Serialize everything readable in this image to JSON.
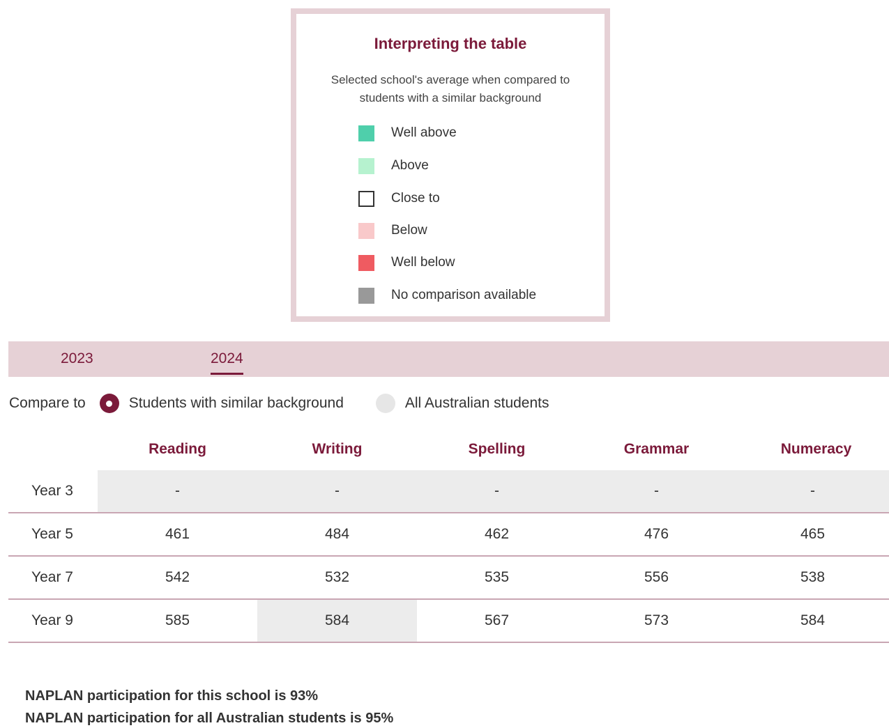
{
  "legend": {
    "title": "Interpreting the table",
    "subtitle_line1": "Selected school's average when compared to",
    "subtitle_line2": "students with a similar background",
    "items": [
      {
        "label": "Well above",
        "color": "#4fcfab"
      },
      {
        "label": "Above",
        "color": "#b6f2cf"
      },
      {
        "label": "Close to",
        "color": "#ffffff"
      },
      {
        "label": "Below",
        "color": "#f9c9ca"
      },
      {
        "label": "Well below",
        "color": "#ef5b61"
      },
      {
        "label": "No comparison available",
        "color": "#999999"
      }
    ]
  },
  "tabs": [
    {
      "label": "2023",
      "active": false
    },
    {
      "label": "2024",
      "active": true
    }
  ],
  "compare": {
    "label": "Compare to",
    "options": [
      {
        "label": "Students with similar background",
        "checked": true
      },
      {
        "label": "All Australian students",
        "checked": false
      }
    ]
  },
  "table": {
    "columns": [
      "Reading",
      "Writing",
      "Spelling",
      "Grammar",
      "Numeracy"
    ],
    "rows": [
      {
        "label": "Year 3",
        "values": [
          "-",
          "-",
          "-",
          "-",
          "-"
        ],
        "no_comparison": [
          true,
          true,
          true,
          true,
          true
        ]
      },
      {
        "label": "Year 5",
        "values": [
          "461",
          "484",
          "462",
          "476",
          "465"
        ],
        "no_comparison": [
          false,
          false,
          false,
          false,
          false
        ]
      },
      {
        "label": "Year 7",
        "values": [
          "542",
          "532",
          "535",
          "556",
          "538"
        ],
        "no_comparison": [
          false,
          false,
          false,
          false,
          false
        ]
      },
      {
        "label": "Year 9",
        "values": [
          "585",
          "584",
          "567",
          "573",
          "584"
        ],
        "no_comparison": [
          false,
          true,
          false,
          false,
          false
        ]
      }
    ],
    "no_comparison_bg": "#ececec"
  },
  "participation": {
    "school": "NAPLAN participation for this school is 93%",
    "australia": "NAPLAN participation for all Australian students is 95%"
  },
  "colors": {
    "accent": "#7b1a3a",
    "accent_light": "#e6d1d6"
  }
}
